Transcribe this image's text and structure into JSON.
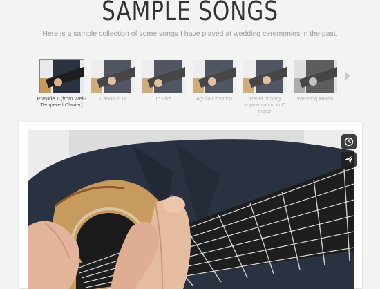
{
  "header": {
    "title": "SAMPLE SONGS",
    "subtitle": "Here is a sample collection of some songs I have played at wedding ceremonies in the past."
  },
  "playlist": {
    "items": [
      {
        "label": "Prelude 1 (from Well-Tempered Clavier)",
        "active": true
      },
      {
        "label": "Canon in D",
        "active": false
      },
      {
        "label": "To Live",
        "active": false
      },
      {
        "label": "Aguila Cosmica",
        "active": false
      },
      {
        "label": "\"Travel picking\" improvisation in C major",
        "active": false
      },
      {
        "label": "Wedding March",
        "active": false
      }
    ],
    "next_icon": "chevron-right-icon"
  },
  "player": {
    "icons": [
      "clock-icon",
      "paper-plane-icon"
    ]
  },
  "colors": {
    "background": "#f3f3f3",
    "title": "#333333",
    "shirt": "#2a3140",
    "fretboard": "#1e1e1e",
    "guitar_body": "#c79a5e"
  }
}
